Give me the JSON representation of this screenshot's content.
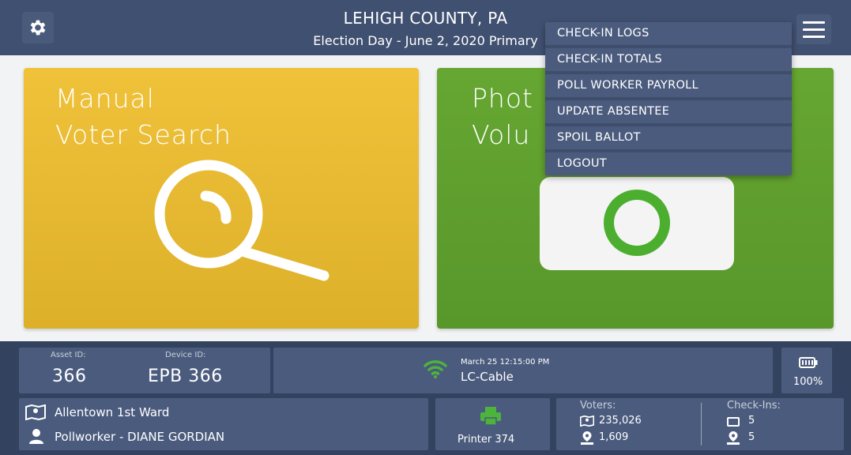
{
  "header": {
    "title": "LEHIGH COUNTY, PA",
    "subtitle": "Election Day - June 2, 2020 Primary"
  },
  "tiles": {
    "manual": {
      "line1": "Manual",
      "line2": "Voter Search"
    },
    "photo": {
      "line1": "Phot",
      "line2": "Volu"
    }
  },
  "menu": {
    "items": [
      "CHECK-IN LOGS",
      "CHECK-IN TOTALS",
      "POLL WORKER PAYROLL",
      "UPDATE ABSENTEE",
      "SPOIL BALLOT",
      "LOGOUT"
    ]
  },
  "status": {
    "asset_label": "Asset ID:",
    "asset_value": "366",
    "device_label": "Device ID:",
    "device_value": "EPB 366",
    "datetime": "March 25  12:15:00 PM",
    "network": "LC-Cable",
    "battery": "100%",
    "location": "Allentown 1st Ward",
    "pollworker": "Pollworker - DIANE GORDIAN",
    "printer": "Printer 374",
    "voters_label": "Voters:",
    "voters_ward": "235,026",
    "voters_loc": "1,609",
    "checkins_label": "Check-Ins:",
    "checkins_device": "5",
    "checkins_loc": "5"
  },
  "colors": {
    "header_bg": "#405070",
    "manual_tile": "#e8b930",
    "photo_tile": "#5fa02e",
    "footer_bg": "#33425f",
    "panel_bg": "#4b5b7d",
    "accent_green": "#4cb43c"
  },
  "icons": [
    "gear-icon",
    "hamburger-icon",
    "magnifier-icon",
    "camera-icon",
    "wifi-icon",
    "battery-icon",
    "map-icon",
    "user-icon",
    "printer-icon",
    "device-icon",
    "pin-icon"
  ]
}
